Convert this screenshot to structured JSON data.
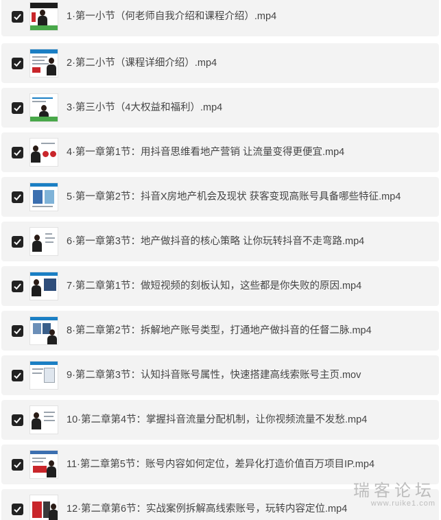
{
  "items": [
    {
      "label": "1·第一小节（何老师自我介绍和课程介绍）.mp4",
      "checked": true
    },
    {
      "label": "2·第二小节（课程详细介绍）.mp4",
      "checked": true
    },
    {
      "label": "3·第三小节（4大权益和福利）.mp4",
      "checked": true
    },
    {
      "label": "4·第一章第1节：用抖音思维看地产营销 让流量变得更便宜.mp4",
      "checked": true
    },
    {
      "label": "5·第一章第2节：抖音X房地产机会及现状 获客变现高账号具备哪些特征.mp4",
      "checked": true
    },
    {
      "label": "6·第一章第3节：地产做抖音的核心策略 让你玩转抖音不走弯路.mp4",
      "checked": true
    },
    {
      "label": "7·第二章第1节：做短视频的刻板认知，这些都是你失败的原因.mp4",
      "checked": true
    },
    {
      "label": "8·第二章第2节：拆解地产账号类型，打通地产做抖音的任督二脉.mp4",
      "checked": true
    },
    {
      "label": "9·第二章第3节：认知抖音账号属性，快速搭建高线索账号主页.mov",
      "checked": true
    },
    {
      "label": "10·第二章第4节：掌握抖音流量分配机制，让你视频流量不发愁.mp4",
      "checked": true
    },
    {
      "label": "11·第二章第5节：账号内容如何定位，差异化打造价值百万项目IP.mp4",
      "checked": true
    },
    {
      "label": "12·第二章第6节：实战案例拆解高线索账号，玩转内容定位.mp4",
      "checked": true
    }
  ],
  "icons": {
    "checkbox": "checkbox-checked-icon"
  },
  "colors": {
    "row_bg": "#f3f3f3",
    "checkbox_bg": "#222222",
    "text": "#444444"
  },
  "watermark": {
    "title": "瑞客论坛",
    "url": "www.ruike1.com"
  }
}
